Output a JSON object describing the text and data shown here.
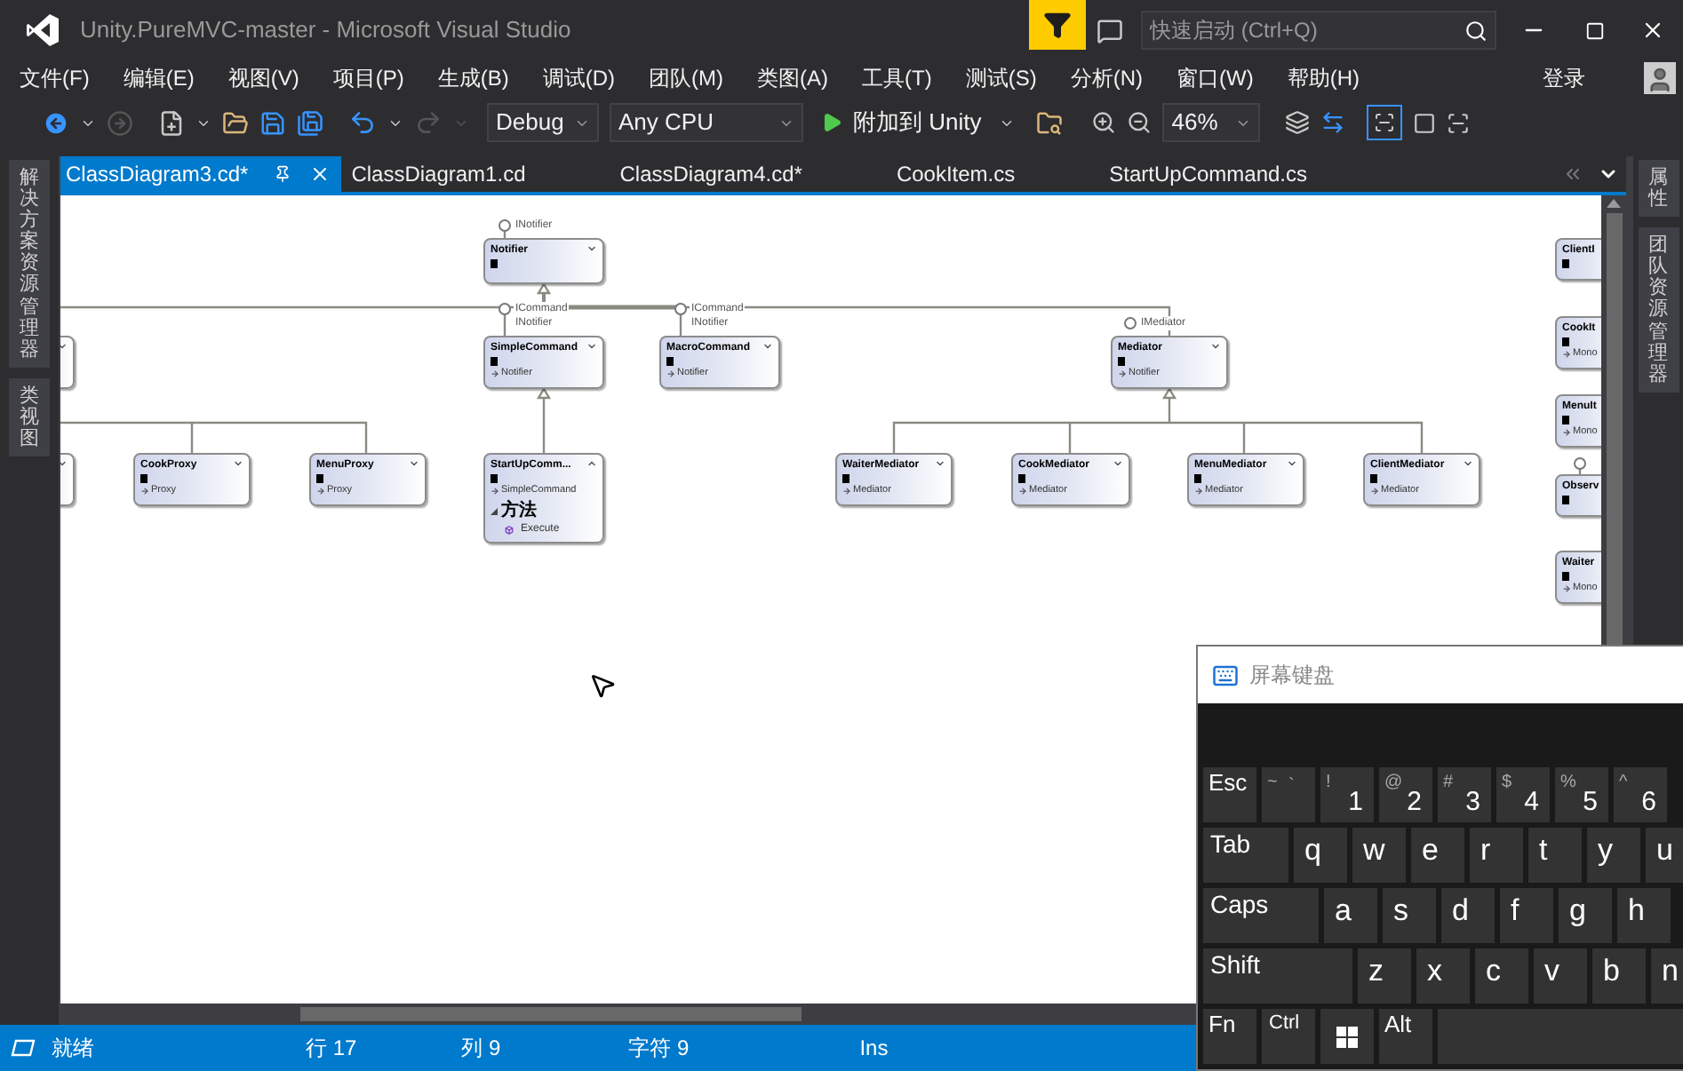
{
  "window": {
    "title": "Unity.PureMVC-master - Microsoft Visual Studio"
  },
  "quick_launch": {
    "placeholder": "快速启动 (Ctrl+Q)"
  },
  "menu": [
    "文件(F)",
    "编辑(E)",
    "视图(V)",
    "项目(P)",
    "生成(B)",
    "调试(D)",
    "团队(M)",
    "类图(A)",
    "工具(T)",
    "测试(S)",
    "分析(N)",
    "窗口(W)",
    "帮助(H)"
  ],
  "sign_in": "登录",
  "toolbar": {
    "configuration": "Debug",
    "platform": "Any CPU",
    "run": "附加到 Unity",
    "zoom": "46%"
  },
  "left_tool_tabs": [
    {
      "label": "解决方案资源管理器"
    },
    {
      "label": "类视图"
    }
  ],
  "tabs": [
    {
      "label": "ClassDiagram3.cd*",
      "selected": true
    },
    {
      "label": "ClassDiagram1.cd",
      "selected": false
    },
    {
      "label": "ClassDiagram4.cd*",
      "selected": false
    },
    {
      "label": "CookItem.cs",
      "selected": false
    },
    {
      "label": "StartUpCommand.cs",
      "selected": false
    }
  ],
  "diagram": {
    "interfaces": [
      {
        "kind": "lollipop",
        "label": "INotifier"
      },
      {
        "kind": "lollipop",
        "label": "ICommand"
      },
      {
        "kind": "label",
        "label": "INotifier"
      },
      {
        "kind": "lollipop",
        "label": "ICommand"
      },
      {
        "kind": "label",
        "label": "INotifier"
      },
      {
        "kind": "lollipop",
        "label": "IMediator"
      },
      {
        "kind": "lollipop"
      }
    ],
    "nodes": [
      {
        "name": "Notifier",
        "expanded": false
      },
      {
        "expanded": false
      },
      {
        "name": "SimpleCommand",
        "base": "Notifier",
        "expanded": false
      },
      {
        "name": "MacroCommand",
        "base": "Notifier",
        "expanded": false
      },
      {
        "name": "Mediator",
        "base": "Notifier",
        "expanded": false
      },
      {
        "expanded": false
      },
      {
        "name": "CookProxy",
        "base": "Proxy",
        "expanded": false
      },
      {
        "name": "MenuProxy",
        "base": "Proxy",
        "expanded": false
      },
      {
        "name": "StartUpComm...",
        "base": "SimpleCommand",
        "expanded": true,
        "section": "方法",
        "members": [
          "Execute"
        ]
      },
      {
        "name": "WaiterMediator",
        "base": "Mediator",
        "expanded": false
      },
      {
        "name": "CookMediator",
        "base": "Mediator",
        "expanded": false
      },
      {
        "name": "MenuMediator",
        "base": "Mediator",
        "expanded": false
      },
      {
        "name": "ClientMediator",
        "base": "Mediator",
        "expanded": false
      },
      {
        "name": "ClientI"
      },
      {
        "name": "CookIt",
        "base": "Mono"
      },
      {
        "name": "MenuIt",
        "base": "Mono"
      },
      {
        "name": "Observ"
      },
      {
        "name": "Waiter",
        "base": "Mono"
      }
    ]
  },
  "right_tool_tabs": [
    {
      "label": "属性"
    },
    {
      "label": "团队资源管理器"
    }
  ],
  "status_bar": {
    "text": "就绪",
    "line": "行 17",
    "column": "列 9",
    "char": "字符 9",
    "mode": "Ins"
  },
  "keyboard": {
    "title": "屏幕键盘",
    "rows": [
      [
        {
          "kind": "key",
          "label": "Esc"
        },
        {
          "kind": "pair",
          "upper": "~",
          "lower": "`"
        },
        {
          "kind": "digit",
          "upper": "!",
          "lower": "1"
        },
        {
          "kind": "digit",
          "upper": "@",
          "lower": "2"
        },
        {
          "kind": "digit",
          "upper": "#",
          "lower": "3"
        },
        {
          "kind": "digit",
          "upper": "$",
          "lower": "4"
        },
        {
          "kind": "digit",
          "upper": "%",
          "lower": "5"
        },
        {
          "kind": "digit",
          "upper": "^",
          "lower": "6"
        }
      ],
      [
        {
          "kind": "tab",
          "label": "Tab"
        },
        {
          "kind": "letter",
          "label": "q"
        },
        {
          "kind": "letter",
          "label": "w"
        },
        {
          "kind": "letter",
          "label": "e"
        },
        {
          "kind": "letter",
          "label": "r"
        },
        {
          "kind": "letter",
          "label": "t"
        },
        {
          "kind": "letter",
          "label": "y"
        },
        {
          "kind": "letter",
          "label": "u"
        }
      ],
      [
        {
          "kind": "caps",
          "label": "Caps"
        },
        {
          "kind": "letter",
          "label": "a"
        },
        {
          "kind": "letter",
          "label": "s"
        },
        {
          "kind": "letter",
          "label": "d"
        },
        {
          "kind": "letter",
          "label": "f"
        },
        {
          "kind": "letter",
          "label": "g"
        },
        {
          "kind": "letter",
          "label": "h"
        }
      ],
      [
        {
          "kind": "shift",
          "label": "Shift"
        },
        {
          "kind": "letter",
          "label": "z"
        },
        {
          "kind": "letter",
          "label": "x"
        },
        {
          "kind": "letter",
          "label": "c"
        },
        {
          "kind": "letter",
          "label": "v"
        },
        {
          "kind": "letter",
          "label": "b"
        },
        {
          "kind": "letter",
          "label": "n"
        }
      ],
      [
        {
          "kind": "key",
          "label": "Fn"
        },
        {
          "kind": "small",
          "label": "Ctrl"
        },
        {
          "kind": "win"
        },
        {
          "kind": "key",
          "label": "Alt"
        },
        {
          "kind": "space"
        }
      ]
    ]
  }
}
